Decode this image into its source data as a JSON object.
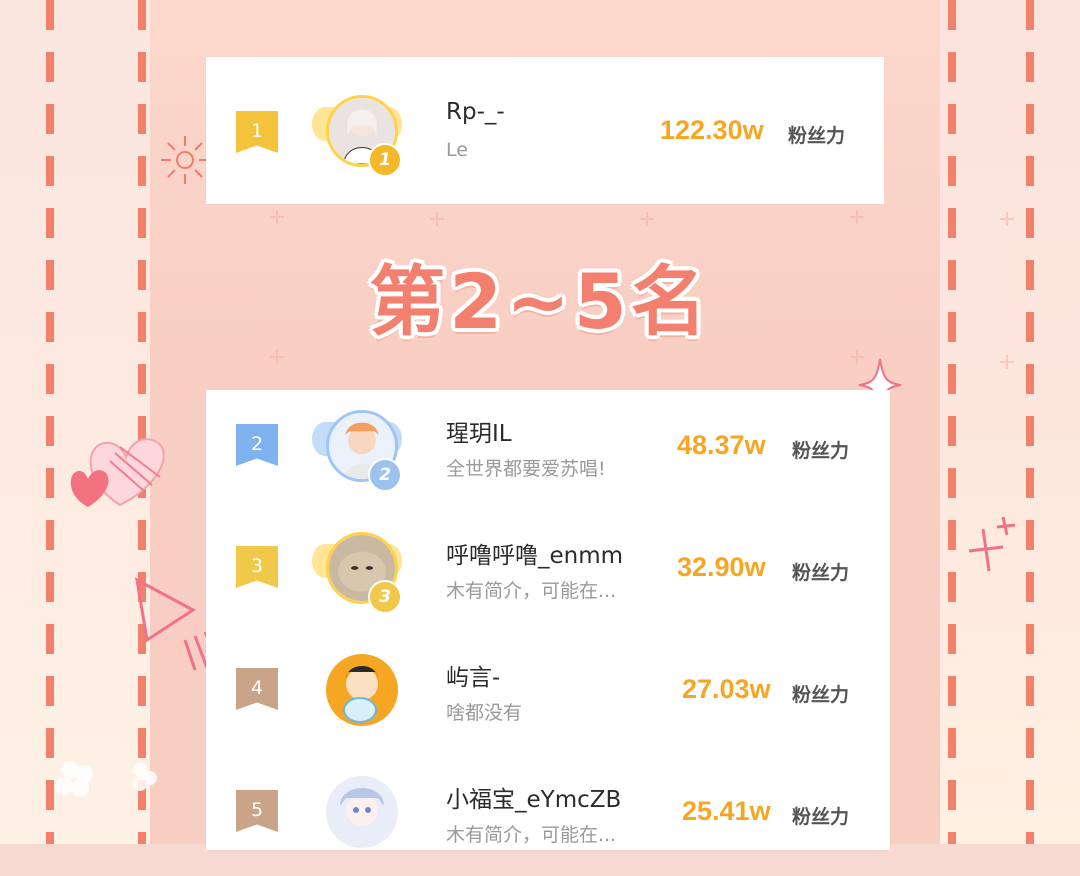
{
  "top": {
    "rank": "1",
    "medal": "1",
    "name": "Rp-_-",
    "desc": "Le",
    "fans_value": "122.30w",
    "fans_label": "粉丝力"
  },
  "section_title": "第2~5名",
  "list": [
    {
      "rank": "2",
      "medal": "2",
      "name": "瑆玥IL",
      "desc": "全世界都要爱苏唱!",
      "fans_value": "48.37w",
      "fans_label": "粉丝力"
    },
    {
      "rank": "3",
      "medal": "3",
      "name": "呼噜呼噜_enmm",
      "desc": "木有简介，可能在...",
      "fans_value": "32.90w",
      "fans_label": "粉丝力"
    },
    {
      "rank": "4",
      "name": "屿言-",
      "desc": "啥都没有",
      "fans_value": "27.03w",
      "fans_label": "粉丝力"
    },
    {
      "rank": "5",
      "name": "小福宝_eYmcZB",
      "desc": "木有简介，可能在...",
      "fans_value": "25.41w",
      "fans_label": "粉丝力"
    }
  ],
  "colors": {
    "fans": "#f6a623",
    "rank1": "#f5c33b",
    "rank2": "#7fb2ef",
    "rank3": "#f0c84a",
    "rank4": "#c9a488",
    "rank5": "#c9a488",
    "title": "#f37f6f"
  },
  "icons": [
    "crown-wings-icon",
    "medal-icon",
    "heart-icon",
    "sparkle-icon",
    "triangle-icon"
  ]
}
